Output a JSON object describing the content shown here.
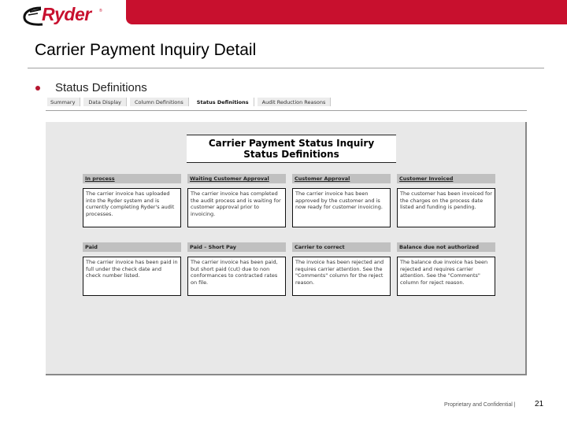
{
  "header": {
    "brand": "Ryder",
    "brand_mark": "®",
    "brand_color": "#c8102e"
  },
  "page_title": "Carrier Payment Inquiry Detail",
  "section": {
    "bullet_color": "#b5162f",
    "label": "Status Definitions"
  },
  "tabs": [
    {
      "label": "Summary",
      "active": false
    },
    {
      "label": "Data Display",
      "active": false
    },
    {
      "label": "Column Definitions",
      "active": false
    },
    {
      "label": "Status Definitions",
      "active": true
    },
    {
      "label": "Audit Reduction Reasons",
      "active": false
    }
  ],
  "panel": {
    "title_line1": "Carrier Payment Status Inquiry",
    "title_line2": "Status Definitions",
    "statuses": [
      {
        "name": "In process",
        "description": "The carrier invoice has uploaded into the Ryder system and is currently completing Ryder's audit processes."
      },
      {
        "name": "Waiting Customer Approval",
        "description": "The carrier invoice has completed the audit process and is waiting for customer approval prior to invoicing."
      },
      {
        "name": "Customer Approval",
        "description": "The carrier invoice has been approved by the customer and is now ready for customer invoicing."
      },
      {
        "name": "Customer Invoiced",
        "description": "The customer has been invoiced for the charges on the process date listed and funding is pending."
      },
      {
        "name": "Paid",
        "description": "The carrier invoice has been paid in full under the check date and check number listed."
      },
      {
        "name": "Paid – Short Pay",
        "description": "The carrier invoice has been paid, but short paid (cut) due to non conformances to contracted rates on file."
      },
      {
        "name": "Carrier to correct",
        "description": "The invoice has been rejected and requires carrier attention. See the \"Comments\" column for the reject reason."
      },
      {
        "name": "Balance due not authorized",
        "description": "The balance due invoice has been rejected and requires carrier attention. See the \"Comments\" column for reject reason."
      }
    ]
  },
  "footer": {
    "confidential": "Proprietary and Confidential |",
    "page_number": "21"
  }
}
